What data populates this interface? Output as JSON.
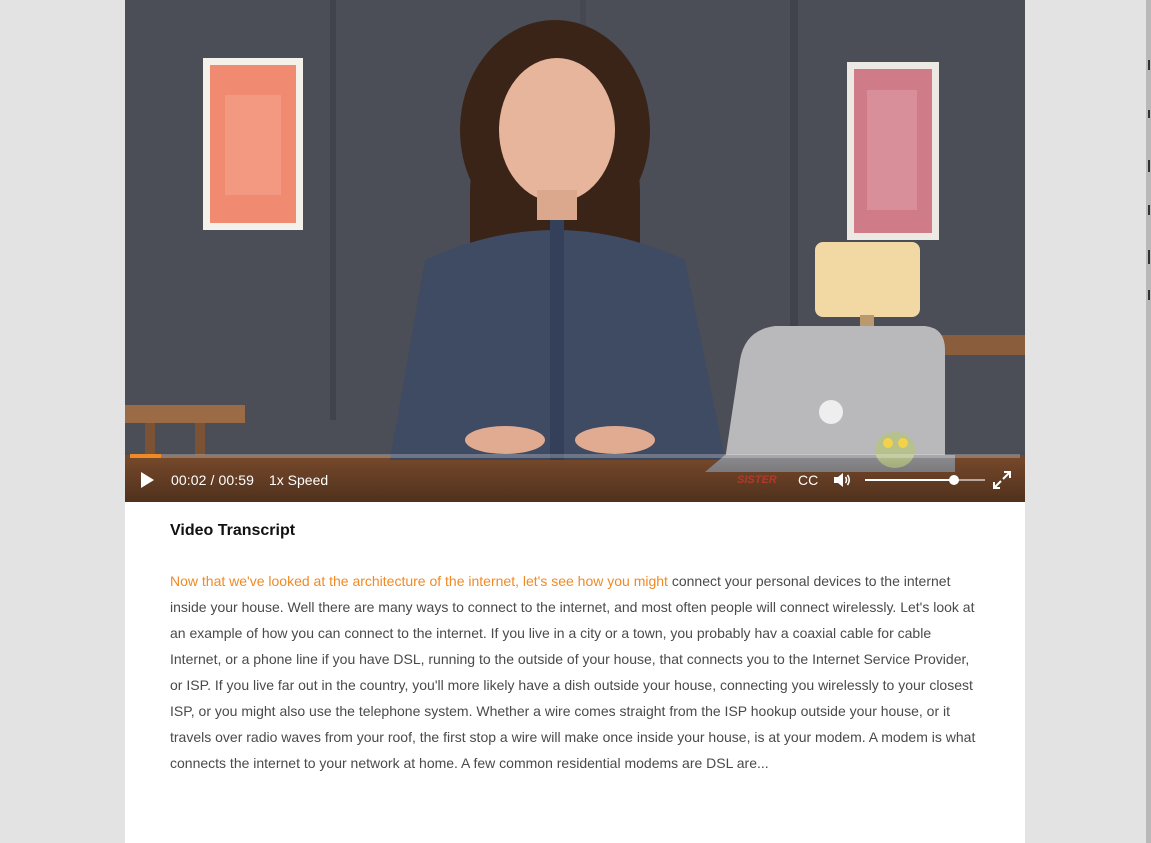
{
  "player": {
    "current_time": "00:02",
    "duration": "00:59",
    "time_separator": " / ",
    "speed_label": "1x Speed",
    "cc_label": "CC",
    "progress_fraction": 0.035,
    "volume_fraction": 0.74,
    "watermark_text": "SISTER",
    "accent_color": "#f08a24",
    "icons": [
      "play-icon",
      "volume-icon",
      "fullscreen-icon"
    ]
  },
  "transcript": {
    "heading": "Video Transcript",
    "highlighted_text": "Now that we've looked at the architecture of the internet, let's see how you might",
    "remaining_text": " connect your personal devices to the internet inside your house. Well there are many ways to connect to the internet, and most often people will connect wirelessly. Let's look at an example of how you can connect to the internet. If you live in a city or a town, you probably hav a coaxial cable for cable Internet, or a phone line if you have DSL, running to the outside of your house, that connects you to the Internet Service Provider, or ISP. If you live far out in the country, you'll more likely have a dish outside your house, connecting you wirelessly to your closest ISP, or you might also use the telephone system. Whether a wire comes straight from the ISP hookup outside your house, or it travels over radio waves from your roof, the first stop a wire will make once inside your house, is at your modem. A modem is what connects the internet to your network at home. A few common residential modems are DSL are...",
    "highlight_color": "#f08a24"
  }
}
